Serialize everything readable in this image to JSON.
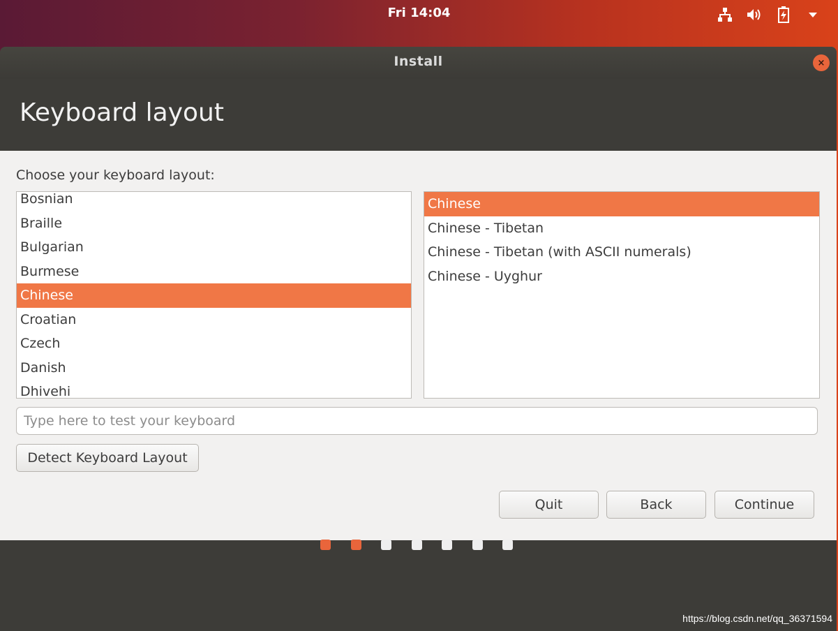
{
  "topbar": {
    "clock": "Fri 14:04",
    "tray_icons": [
      "network-icon",
      "volume-icon",
      "battery-icon",
      "system-menu-arrow-icon"
    ]
  },
  "window": {
    "title": "Install",
    "close_label": "×"
  },
  "page": {
    "title": "Keyboard layout",
    "prompt": "Choose your keyboard layout:"
  },
  "layouts": {
    "items": [
      "Bosnian",
      "Braille",
      "Bulgarian",
      "Burmese",
      "Chinese",
      "Croatian",
      "Czech",
      "Danish",
      "Dhivehi"
    ],
    "selected": "Chinese"
  },
  "variants": {
    "items": [
      "Chinese",
      "Chinese - Tibetan",
      "Chinese - Tibetan (with ASCII numerals)",
      "Chinese - Uyghur"
    ],
    "selected": "Chinese"
  },
  "test_field": {
    "placeholder": "Type here to test your keyboard",
    "value": ""
  },
  "buttons": {
    "detect": "Detect Keyboard Layout",
    "quit": "Quit",
    "back": "Back",
    "continue": "Continue"
  },
  "progress": {
    "total_steps": 7,
    "completed_steps": 2
  },
  "watermark": "https://blog.csdn.net/qq_36371594",
  "colors": {
    "accent": "#f07746",
    "window_dark": "#3d3c38",
    "content_bg": "#f2f1f0",
    "dot_inactive": "#efefef"
  }
}
